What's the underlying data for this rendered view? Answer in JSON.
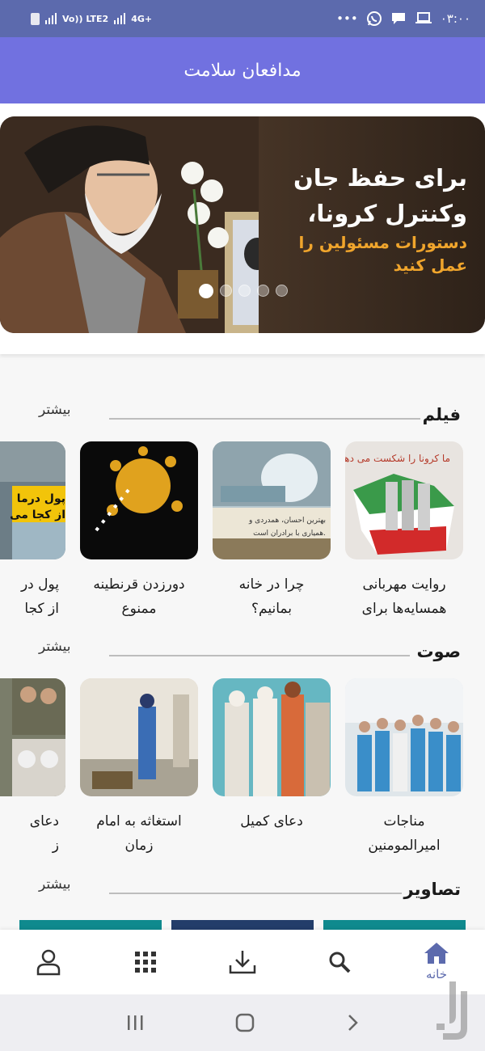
{
  "status_bar": {
    "time": "۰۳:۰۰",
    "network_label": "Vo)) LTE2",
    "data_label": "4G+",
    "overflow": "•••"
  },
  "app_bar": {
    "title": "مدافعان سلامت"
  },
  "banner": {
    "line1": "برای حفظ جان",
    "line2": "وکنترل کرونا،",
    "line3": "دستورات مسئولین را",
    "line4": "عمل کنید",
    "slide_count": 5,
    "active_slide": 1
  },
  "sections": [
    {
      "title": "فیلم",
      "more": "بیشتر",
      "items": [
        {
          "l1": "روایت مهربانی",
          "l2": "همسایه‌ها برای"
        },
        {
          "l1": "چرا در خانه",
          "l2": "بمانیم؟"
        },
        {
          "l1": "دورزدن قرنطینه",
          "l2": "ممنوع"
        },
        {
          "l1": "پول در",
          "l2": "از کجا"
        }
      ]
    },
    {
      "title": "صوت",
      "more": "بیشتر",
      "items": [
        {
          "l1": "مناجات",
          "l2": "امیرالمومنین"
        },
        {
          "l1": "دعای کمیل",
          "l2": ""
        },
        {
          "l1": "استغاثه به امام",
          "l2": "زمان"
        },
        {
          "l1": "دعای",
          "l2": "ز"
        }
      ]
    },
    {
      "title": "تصاویر",
      "more": "بیشتر",
      "items": []
    }
  ],
  "thumb_text": {
    "film2_line1": "بهترین احسان، همدردی و",
    "film2_line2": "همیاری با برادران است.",
    "film1_overlay": "ما کرونا را شکست می دهیم",
    "film4_line1": "پول درما",
    "film4_line2": "از کجا می"
  },
  "bottom_nav": {
    "home_label": "خانه",
    "items": [
      "profile",
      "categories",
      "download",
      "search",
      "home"
    ]
  },
  "colors": {
    "status_bar": "#5c6aad",
    "app_bar": "#7171e0",
    "accent": "#5c6aad",
    "banner_highlight": "#f0a52c"
  }
}
